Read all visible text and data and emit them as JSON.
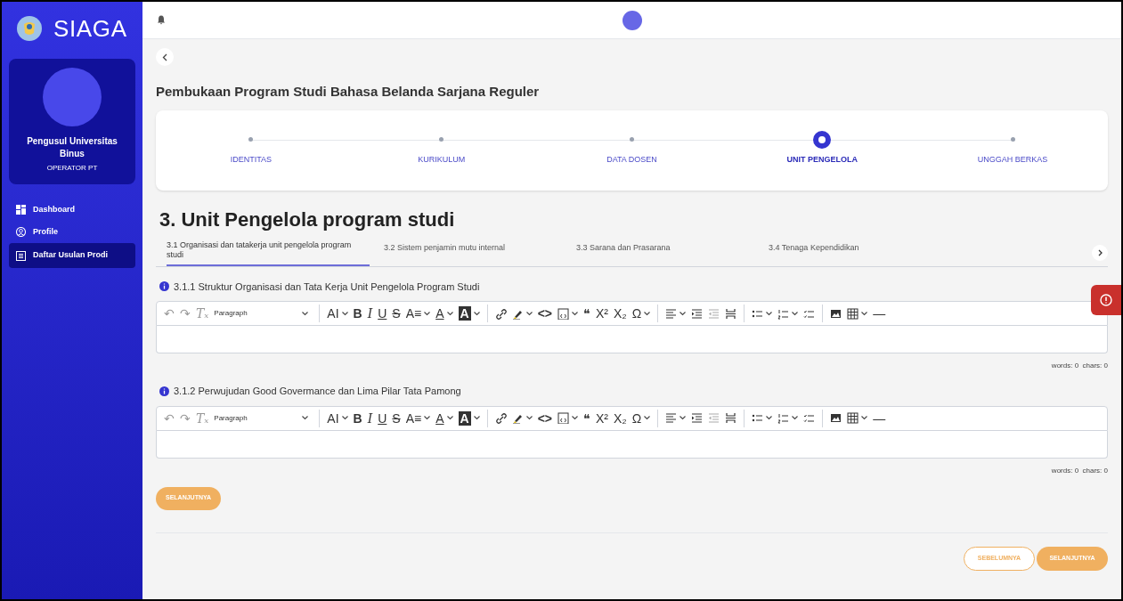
{
  "sidebar": {
    "app_name": "SIAGA",
    "profile": {
      "name": "Pengusul Universitas Binus",
      "role": "OPERATOR PT"
    },
    "items": [
      {
        "label": "Dashboard",
        "kind": "dashboard",
        "selected": false
      },
      {
        "label": "Profile",
        "kind": "profile",
        "selected": false
      },
      {
        "label": "Daftar Usulan Prodi",
        "kind": "list",
        "selected": true
      }
    ]
  },
  "page_title": "Pembukaan Program Studi Bahasa Belanda Sarjana Reguler",
  "steps": [
    {
      "label": "IDENTITAS",
      "selected": false
    },
    {
      "label": "KURIKULUM",
      "selected": false
    },
    {
      "label": "DATA DOSEN",
      "selected": false
    },
    {
      "label": "UNIT PENGELOLA",
      "selected": true
    },
    {
      "label": "UNGGAH BERKAS",
      "selected": false
    }
  ],
  "section_title": "3. Unit Pengelola program studi",
  "tabs": [
    {
      "label": "3.1 Organisasi dan tatakerja unit pengelola program studi",
      "selected": true
    },
    {
      "label": "3.2 Sistem penjamin mutu internal",
      "selected": false
    },
    {
      "label": "3.3 Sarana dan Prasarana",
      "selected": false
    },
    {
      "label": "3.4 Tenaga Kependidikan",
      "selected": false
    }
  ],
  "fields": [
    {
      "label": "3.1.1 Struktur Organisasi dan Tata Kerja Unit Pengelola Program Studi",
      "counter": "words: 0  chars: 0",
      "toolbar": [
        {
          "kind": "undo",
          "text": "↶"
        },
        {
          "kind": "redo",
          "text": "↷"
        },
        {
          "kind": "clear",
          "text": "Tₓ"
        },
        {
          "kind": "select",
          "text": "Paragraph"
        },
        {
          "kind": "separator"
        },
        {
          "kind": "fontsize",
          "text": "AI"
        },
        {
          "kind": "bold",
          "text": "B"
        },
        {
          "kind": "italic",
          "text": "I"
        },
        {
          "kind": "underline",
          "text": "U"
        },
        {
          "kind": "strike",
          "text": "S"
        },
        {
          "kind": "fontfamily",
          "text": "A≡"
        },
        {
          "kind": "fontcolor",
          "text": "A"
        },
        {
          "kind": "bgcolor",
          "text": "A"
        },
        {
          "kind": "separator"
        },
        {
          "kind": "link"
        },
        {
          "kind": "highlight"
        },
        {
          "kind": "code",
          "text": "<>"
        },
        {
          "kind": "source"
        },
        {
          "kind": "quote",
          "text": "❝"
        },
        {
          "kind": "superscript",
          "text": "X²"
        },
        {
          "kind": "subscript",
          "text": "X₂"
        },
        {
          "kind": "special",
          "text": "Ω"
        },
        {
          "kind": "separator"
        },
        {
          "kind": "align"
        },
        {
          "kind": "indent"
        },
        {
          "kind": "outdent"
        },
        {
          "kind": "pagebreak"
        },
        {
          "kind": "separator"
        },
        {
          "kind": "bullets"
        },
        {
          "kind": "numbers"
        },
        {
          "kind": "todo"
        },
        {
          "kind": "separator"
        },
        {
          "kind": "image"
        },
        {
          "kind": "table"
        },
        {
          "kind": "hr",
          "text": "—"
        }
      ]
    },
    {
      "label": "3.1.2 Perwujudan Good Govermance dan Lima Pilar Tata Pamong",
      "counter": "words: 0  chars: 0",
      "toolbar": [
        {
          "kind": "undo",
          "text": "↶"
        },
        {
          "kind": "redo",
          "text": "↷"
        },
        {
          "kind": "clear",
          "text": "Tₓ"
        },
        {
          "kind": "select",
          "text": "Paragraph"
        },
        {
          "kind": "separator"
        },
        {
          "kind": "fontsize",
          "text": "AI"
        },
        {
          "kind": "bold",
          "text": "B"
        },
        {
          "kind": "italic",
          "text": "I"
        },
        {
          "kind": "underline",
          "text": "U"
        },
        {
          "kind": "strike",
          "text": "S"
        },
        {
          "kind": "fontfamily",
          "text": "A≡"
        },
        {
          "kind": "fontcolor",
          "text": "A"
        },
        {
          "kind": "bgcolor",
          "text": "A"
        },
        {
          "kind": "separator"
        },
        {
          "kind": "link"
        },
        {
          "kind": "highlight"
        },
        {
          "kind": "code",
          "text": "<>"
        },
        {
          "kind": "source"
        },
        {
          "kind": "quote",
          "text": "❝"
        },
        {
          "kind": "superscript",
          "text": "X²"
        },
        {
          "kind": "subscript",
          "text": "X₂"
        },
        {
          "kind": "special",
          "text": "Ω"
        },
        {
          "kind": "separator"
        },
        {
          "kind": "align"
        },
        {
          "kind": "indent"
        },
        {
          "kind": "outdent"
        },
        {
          "kind": "pagebreak"
        },
        {
          "kind": "separator"
        },
        {
          "kind": "bullets"
        },
        {
          "kind": "numbers"
        },
        {
          "kind": "todo"
        },
        {
          "kind": "separator"
        },
        {
          "kind": "image"
        },
        {
          "kind": "table"
        },
        {
          "kind": "hr",
          "text": "—"
        }
      ]
    }
  ],
  "inline_button": "SELANJUTNYA",
  "footer_buttons": [
    {
      "label": "SEBELUMNYA",
      "kind": "outline"
    },
    {
      "label": "SELANJUTNYA",
      "kind": "filled"
    }
  ]
}
